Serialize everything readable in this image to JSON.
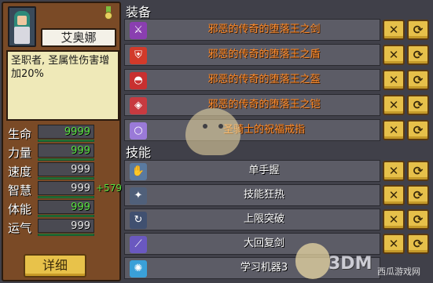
{
  "character": {
    "name": "艾奥娜",
    "description": "圣职者, 圣属性伤害增加20%",
    "detail_button": "详细"
  },
  "stats": [
    {
      "label": "生命",
      "value": "9999",
      "green": true,
      "bonus": ""
    },
    {
      "label": "力量",
      "value": "999",
      "green": true,
      "bonus": ""
    },
    {
      "label": "速度",
      "value": "999",
      "green": false,
      "bonus": ""
    },
    {
      "label": "智慧",
      "value": "999",
      "green": false,
      "bonus": "+579"
    },
    {
      "label": "体能",
      "value": "999",
      "green": true,
      "bonus": ""
    },
    {
      "label": "运气",
      "value": "999",
      "green": false,
      "bonus": ""
    }
  ],
  "equipment_title": "装备",
  "equipment": [
    {
      "name": "邪恶的传奇的堕落王之剑",
      "icon": "sword-icon"
    },
    {
      "name": "邪恶的传奇的堕落王之盾",
      "icon": "shield-icon"
    },
    {
      "name": "邪恶的传奇的堕落王之盔",
      "icon": "helmet-icon"
    },
    {
      "name": "邪恶的传奇的堕落王之铠",
      "icon": "armor-icon"
    },
    {
      "name": "圣骑士的祝福戒指",
      "icon": "ring-icon"
    }
  ],
  "skills_title": "技能",
  "skills": [
    {
      "name": "单手握",
      "icon": "hand-icon"
    },
    {
      "name": "技能狂热",
      "icon": "fire-icon"
    },
    {
      "name": "上限突破",
      "icon": "break-icon"
    },
    {
      "name": "大回复剑",
      "icon": "slash-icon"
    },
    {
      "name": "学习机器3",
      "icon": "gear-icon"
    }
  ],
  "row_buttons": {
    "remove": "✕",
    "swap": "⟳"
  },
  "watermark": {
    "logo": "3DM",
    "text": "西瓜游戏网"
  },
  "colors": {
    "equip_text": "#ff8a28",
    "stat_green": "#58e040",
    "button": "#e6c04a",
    "panel": "#7a4a26"
  }
}
